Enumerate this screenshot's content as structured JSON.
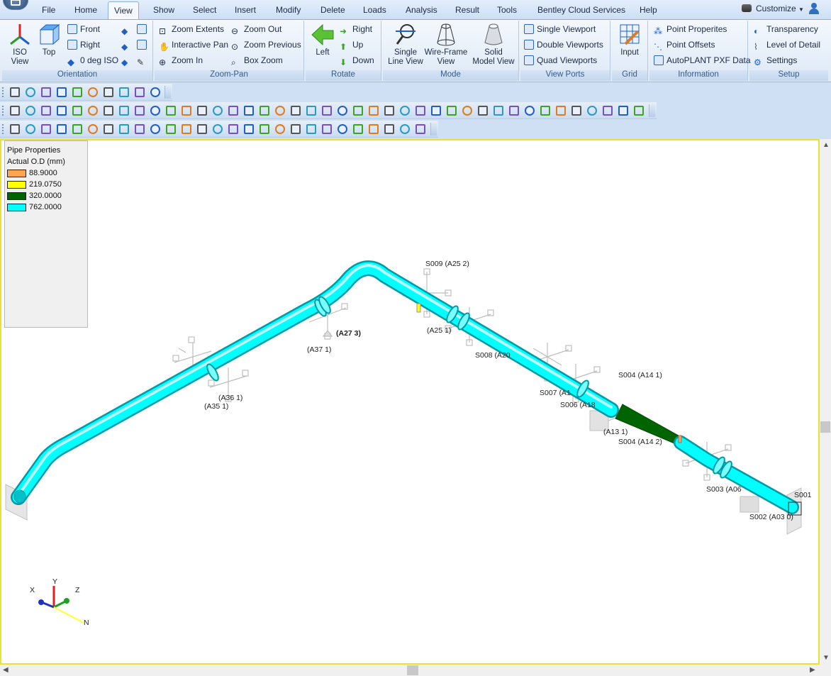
{
  "menubar": {
    "tabs": [
      "File",
      "Home",
      "View",
      "Show",
      "Select",
      "Insert",
      "Modify",
      "Delete",
      "Loads",
      "Analysis",
      "Result",
      "Tools",
      "Bentley Cloud Services",
      "Help"
    ],
    "active": "View",
    "customize": "Customize"
  },
  "ribbon": {
    "orientation": {
      "label": "Orientation",
      "iso": "ISO\nView",
      "top": "Top",
      "front": "Front",
      "right": "Right",
      "zero_iso": "0 deg ISO"
    },
    "zoompan": {
      "label": "Zoom-Pan",
      "zoom_extents": "Zoom Extents",
      "zoom_out": "Zoom Out",
      "interactive_pan": "Interactive Pan",
      "zoom_previous": "Zoom Previous",
      "zoom_in": "Zoom In",
      "box_zoom": "Box Zoom"
    },
    "rotate": {
      "label": "Rotate",
      "left": "Left",
      "right": "Right",
      "up": "Up",
      "down": "Down"
    },
    "mode": {
      "label": "Mode",
      "single_line": "Single\nLine View",
      "wireframe": "Wire-Frame\nView",
      "solid": "Solid\nModel View"
    },
    "viewports": {
      "label": "View Ports",
      "single": "Single Viewport",
      "double": "Double Viewports",
      "quad": "Quad Viewports"
    },
    "grid": {
      "label": "Grid",
      "input": "Input"
    },
    "information": {
      "label": "Information",
      "point_properties": "Point Properites",
      "point_offsets": "Point Offsets",
      "autoplant": "AutoPLANT PXF Data"
    },
    "setup": {
      "label": "Setup",
      "transparency": "Transparency",
      "level_of_detail": "Level of Detail",
      "settings": "Settings"
    }
  },
  "legend": {
    "title": "Pipe Properties",
    "subtitle": "Actual O.D (mm)",
    "items": [
      {
        "value": "88.9000",
        "color": "#ffa54f"
      },
      {
        "value": "219.0750",
        "color": "#ffff00"
      },
      {
        "value": "320.0000",
        "color": "#006400"
      },
      {
        "value": "762.0000",
        "color": "#00ffff"
      }
    ]
  },
  "node_labels": {
    "s009": "S009 (A25  2)",
    "a27": "(A27  3)",
    "a37": "(A37  1)",
    "a25": "(A25  1)",
    "s008": "S008 (A20",
    "a36": "(A36  1)",
    "a35": "(A35  1)",
    "s007": "S007 (A1",
    "s006": "S006 (A18",
    "s004a": "S004 (A14  1)",
    "a13": "(A13  1)",
    "s004b": "S004 (A14  2)",
    "s003": "S003 (A06",
    "s001": "S001",
    "s002": "S002 (A03  0)"
  },
  "axes": {
    "x": "X",
    "y": "Y",
    "z": "Z",
    "n": "N"
  },
  "colors": {
    "pipe": "#00ffff",
    "reducer": "#006400",
    "frame": "#e8e13a"
  }
}
